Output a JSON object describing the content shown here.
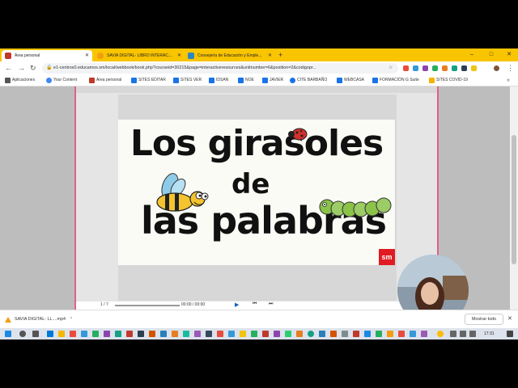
{
  "tabs": [
    {
      "label": "Área personal",
      "active": true,
      "icon_color": "#c0392b"
    },
    {
      "label": "SAVIA DIGITAL- LIBRO INTERAC...",
      "active": false,
      "icon_color": "#f39c12"
    },
    {
      "label": "Consejería de Educación y Emple...",
      "active": false,
      "icon_color": "#2e86c1"
    }
  ],
  "new_tab": "+",
  "window": {
    "minimize": "–",
    "maximize": "□",
    "close": "✕"
  },
  "address": {
    "url": "e1-centros0.educamos.sm/local/webbook/book.php?courseid=30215&page=interactiveresources&unitnumber=6&position=2&codigopr..."
  },
  "bookmarks": [
    {
      "label": "Aplicaciones",
      "color": "#555"
    },
    {
      "label": "Your Content",
      "color": "#4285f4"
    },
    {
      "label": "Área personal",
      "color": "#c0392b"
    },
    {
      "label": "SITES EDITAR",
      "color": "#1a73e8"
    },
    {
      "label": "SITES VER",
      "color": "#1a73e8"
    },
    {
      "label": "IDSAN",
      "color": "#1a73e8"
    },
    {
      "label": "NOE",
      "color": "#1a73e8"
    },
    {
      "label": "JAVIER",
      "color": "#1a73e8"
    },
    {
      "label": "CITE BARBAÑO",
      "color": "#1a73e8"
    },
    {
      "label": "WEBCASA",
      "color": "#1a73e8"
    },
    {
      "label": "FORMACIÓN G Suite",
      "color": "#1a73e8"
    },
    {
      "label": "SITES COVID-19",
      "color": "#f4b400"
    }
  ],
  "slide": {
    "line1": "Los girasoles",
    "line2": "de",
    "line3": "las palabras",
    "logo": "sm"
  },
  "player": {
    "time": "00:00 / 00:00",
    "page": "1 / 7"
  },
  "download": {
    "file": "SAVIA DIGITAL- LL....mp4",
    "show_all": "Mostrar todo"
  },
  "clock": "17:31",
  "colors": {
    "chrome_bar": "#f9c400",
    "viewer_border": "#e0608a",
    "sm_red": "#e11b22"
  }
}
